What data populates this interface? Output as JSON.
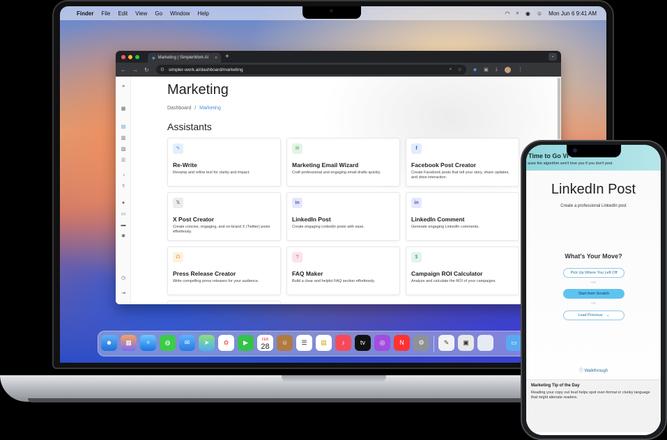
{
  "menubar": {
    "apple": "",
    "app": "Finder",
    "items": [
      "File",
      "Edit",
      "View",
      "Go",
      "Window",
      "Help"
    ],
    "datetime": "Mon Jun 6  9:41 AM"
  },
  "browser": {
    "tab_title": "Marketing | SimplerWork AI",
    "url": "simpler-work.ai/dashboard/marketing"
  },
  "page": {
    "title": "Marketing",
    "breadcrumb_root": "Dashboard",
    "breadcrumb_sep": "/",
    "breadcrumb_current": "Marketing",
    "section_title": "Assistants",
    "cards": [
      {
        "title": "Re-Write",
        "desc": "Revamp and refine text for clarity and impact.",
        "icon": "pencil-icon",
        "color": "#e3f0fb"
      },
      {
        "title": "Marketing Email Wizard",
        "desc": "Craft professional and engaging email drafts quickly.",
        "icon": "email-icon",
        "color": "#e3f3e6"
      },
      {
        "title": "Facebook Post Creator",
        "desc": "Create Facebook posts that tell your story, share updates, and drive interaction.",
        "icon": "facebook-icon",
        "color": "#e3ecfb"
      },
      {
        "title": "X Post Creator",
        "desc": "Create concise, engaging, and on-brand X (Twitter) posts effortlessly.",
        "icon": "x-icon",
        "color": "#ececec"
      },
      {
        "title": "LinkedIn Post",
        "desc": "Create engaging LinkedIn posts with ease.",
        "icon": "linkedin-icon",
        "color": "#e6e8fb"
      },
      {
        "title": "LinkedIn Comment",
        "desc": "Generate engaging LinkedIn comments.",
        "icon": "linkedin-icon",
        "color": "#e6e8fb"
      },
      {
        "title": "Press Release Creator",
        "desc": "Write compelling press releases for your audience.",
        "icon": "megaphone-icon",
        "color": "#fdf1df"
      },
      {
        "title": "FAQ Maker",
        "desc": "Build a clear and helpful FAQ section effortlessly.",
        "icon": "question-icon",
        "color": "#fbe3ea"
      },
      {
        "title": "Campaign ROI Calculator",
        "desc": "Analyze and calculate the ROI of your campaigns.",
        "icon": "dollar-icon",
        "color": "#e3f3ee"
      }
    ]
  },
  "dock": {
    "calendar_month": "FEB",
    "calendar_day": "28"
  },
  "phone": {
    "header_title": "Time to Go Vi",
    "header_sub": "ause the algorithm won't love you if you don't post.",
    "title": "LinkedIn Post",
    "subtitle": "Create a professional LinkedIn post",
    "move_heading": "What's Your Move?",
    "btn_resume": "Pick Up Where You Left Off",
    "or1": "OR",
    "btn_scratch": "Start from Scratch",
    "or2": "OR",
    "btn_load": "Load Previous",
    "walkthrough": "Walkthrough",
    "tip_title": "Marketing Tip of the Day",
    "tip_body": "Reading your copy out loud helps spot over-formal or clunky language that might alienate readers."
  }
}
